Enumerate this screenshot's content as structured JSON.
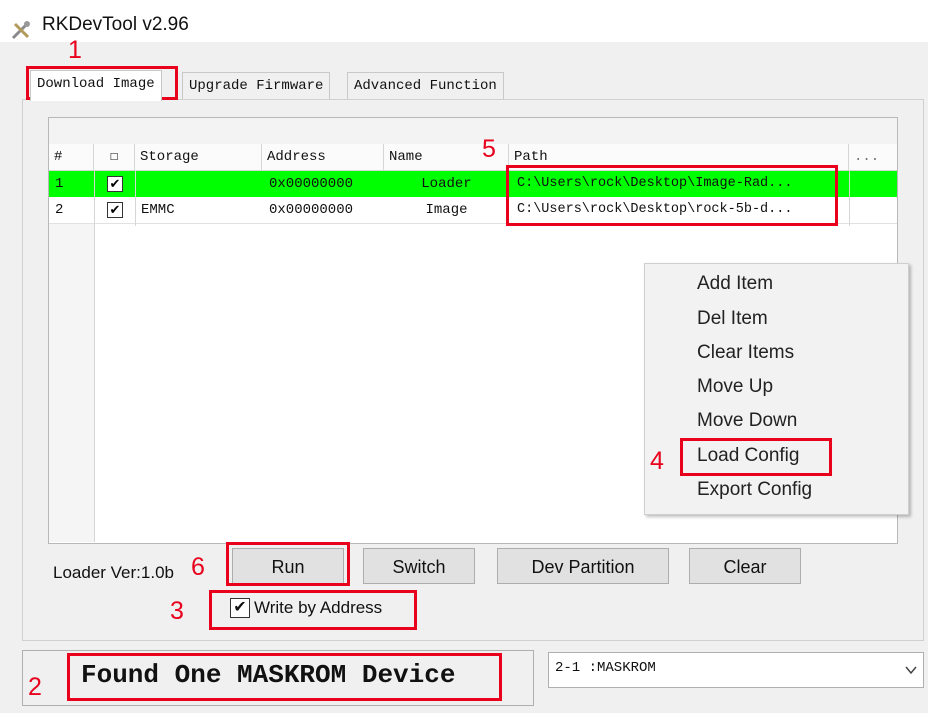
{
  "window": {
    "title": "RKDevTool v2.96",
    "icon": "tools-icon"
  },
  "tabs": [
    {
      "label": "Download Image",
      "active": true
    },
    {
      "label": "Upgrade Firmware",
      "active": false
    },
    {
      "label": "Advanced Function",
      "active": false
    }
  ],
  "table": {
    "columns": [
      "#",
      "☐",
      "Storage",
      "Address",
      "Name",
      "Path",
      "..."
    ],
    "rows": [
      {
        "index": "1",
        "checked": true,
        "storage": "",
        "address": "0x00000000",
        "name": "Loader",
        "path": "C:\\Users\\rock\\Desktop\\Image-Rad...",
        "highlight": true
      },
      {
        "index": "2",
        "checked": true,
        "storage": "EMMC",
        "address": "0x00000000",
        "name": "Image",
        "path": "C:\\Users\\rock\\Desktop\\rock-5b-d...",
        "highlight": false
      }
    ]
  },
  "context_menu": {
    "items": [
      "Add Item",
      "Del Item",
      "Clear Items",
      "Move Up",
      "Move Down",
      "Load Config",
      "Export Config"
    ]
  },
  "bottom": {
    "loader_version": "Loader Ver:1.0b",
    "buttons": {
      "run": "Run",
      "switch": "Switch",
      "dev_partition": "Dev Partition",
      "clear": "Clear"
    },
    "write_by_address": {
      "label": "Write by Address",
      "checked": true
    }
  },
  "status": {
    "message": "Found One MASKROM Device",
    "device_select": "2-1  :MASKROM"
  },
  "annotations": [
    "1",
    "2",
    "3",
    "4",
    "5",
    "6"
  ],
  "colors": {
    "highlight_row": "#00ff00",
    "annotation_red": "#e8001c"
  }
}
